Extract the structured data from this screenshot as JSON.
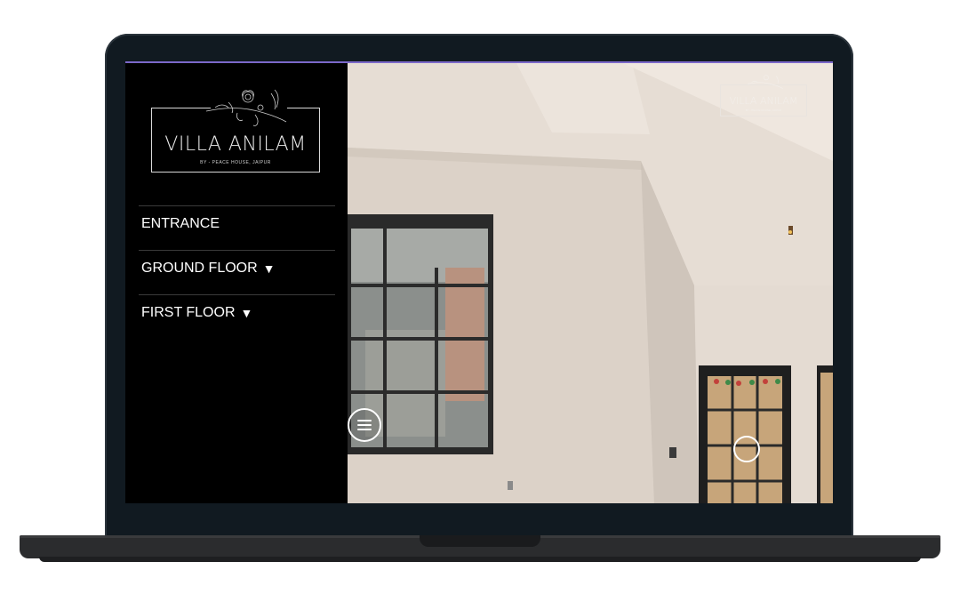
{
  "logo": {
    "title": "VILLA ANILAM",
    "subtitle": "BY - PEACE HOUSE, JAIPUR"
  },
  "menu": {
    "items": [
      {
        "label": "ENTRANCE",
        "has_caret": false
      },
      {
        "label": "GROUND FLOOR",
        "has_caret": true
      },
      {
        "label": "FIRST FLOOR",
        "has_caret": true
      }
    ],
    "caret": "▼"
  },
  "pano_logo": {
    "title": "VILLA ANILAM",
    "subtitle": "BY - PEACE HOUSE, JAIPUR"
  },
  "icons": {
    "menu_toggle": "hamburger-icon",
    "hotspot": "navigation-hotspot-icon",
    "logo_mark": "floral-logo-icon"
  },
  "colors": {
    "sidebar_bg": "#000000",
    "text": "#ffffff",
    "screen_accent": "#7b68c9"
  }
}
